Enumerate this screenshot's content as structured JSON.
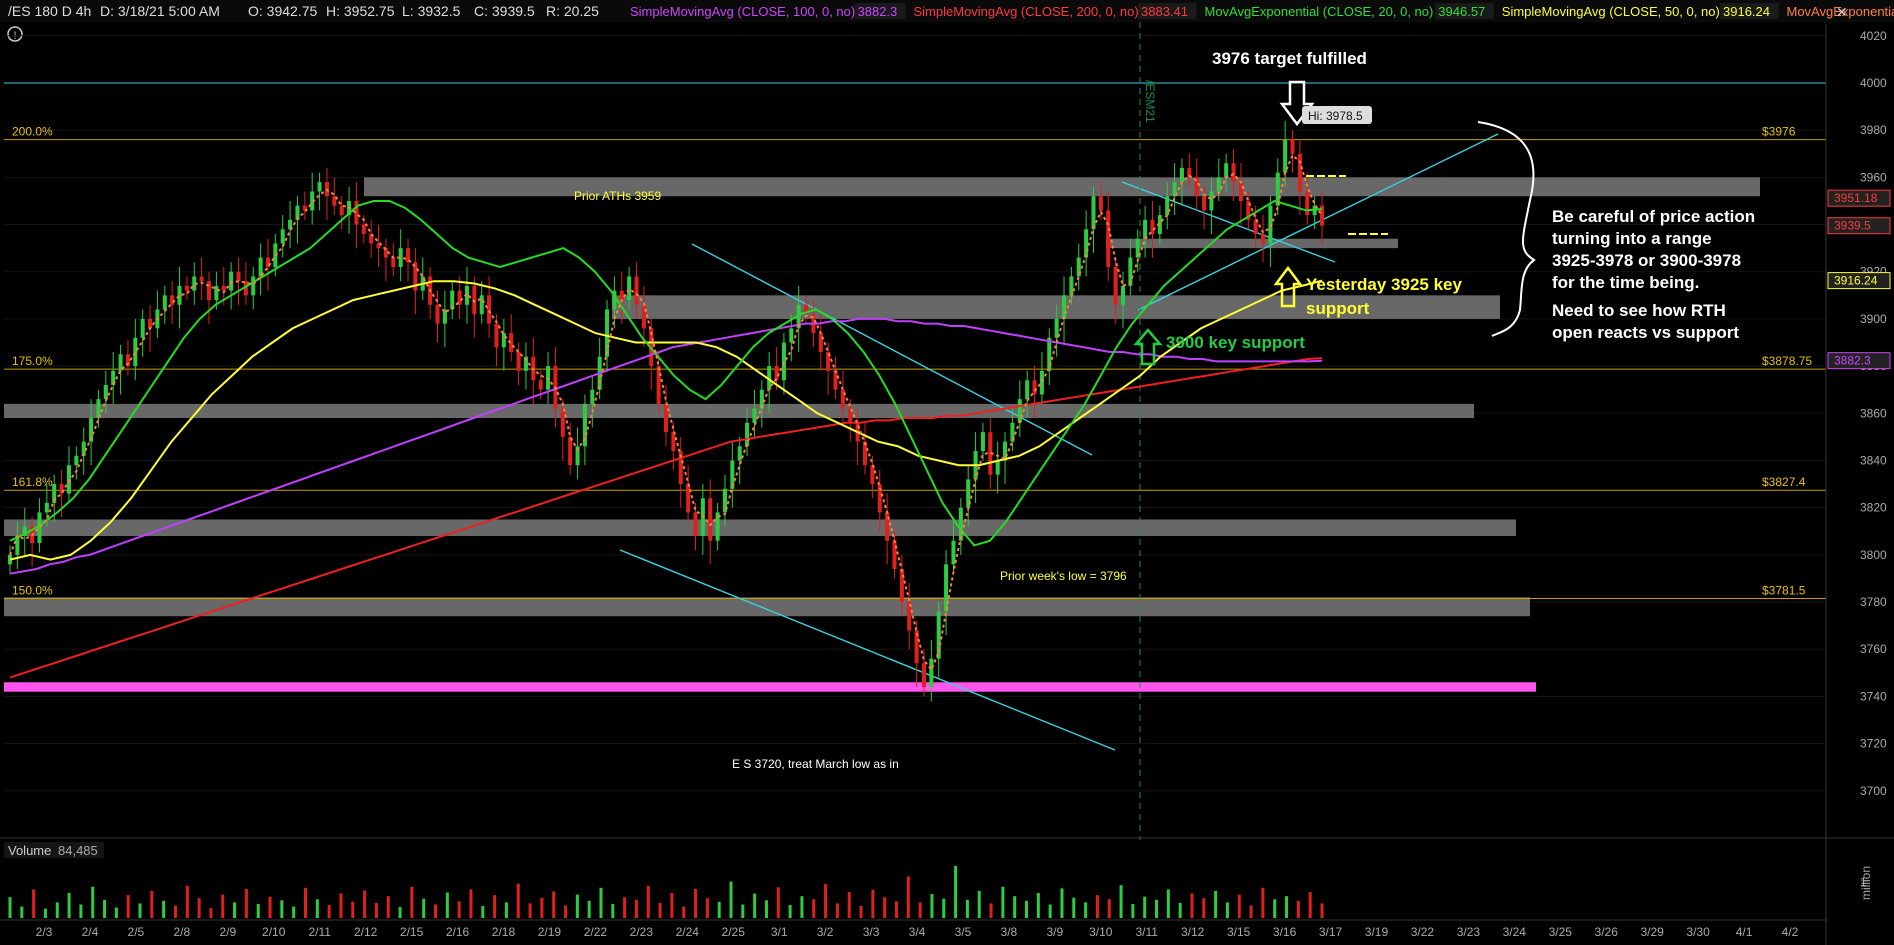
{
  "header": {
    "symbol": "/ES 180 D 4h",
    "date": "D: 3/18/21 5:00 AM",
    "open": "O: 3942.75",
    "high": "H: 3952.75",
    "low": "L: 3932.5",
    "close": "C: 3939.5",
    "range": "R: 20.25",
    "studies": [
      {
        "label": "SimpleMovingAvg (CLOSE, 100, 0, no)",
        "value": "3882.3",
        "color": "#cc44ff"
      },
      {
        "label": "SimpleMovingAvg (CLOSE, 200, 0, no)",
        "value": "3883.41",
        "color": "#ff3a3a"
      },
      {
        "label": "MovAvgExponential (CLOSE, 20, 0, no)",
        "value": "3946.57",
        "color": "#33dd33"
      },
      {
        "label": "SimpleMovingAvg (CLOSE, 50, 0, no)",
        "value": "3916.24",
        "color": "#ffff33"
      },
      {
        "label": "MovAvgExponential ...",
        "value": "",
        "color": "#ff8040"
      }
    ]
  },
  "volume_panel": {
    "label": "Volume",
    "value": "84,485",
    "unit": "million"
  },
  "chart_data": {
    "type": "candlestick",
    "ylim": [
      3680,
      4025
    ],
    "y_ticks": [
      3700,
      3720,
      3740,
      3760,
      3780,
      3800,
      3820,
      3840,
      3860,
      3880,
      3900,
      3920,
      3940,
      3960,
      3980,
      4000,
      4020
    ],
    "x_ticks": [
      "2/3",
      "2/4",
      "2/5",
      "2/8",
      "2/9",
      "2/10",
      "2/11",
      "2/12",
      "2/15",
      "2/16",
      "2/18",
      "2/19",
      "2/22",
      "2/23",
      "2/24",
      "2/25",
      "3/1",
      "3/2",
      "3/3",
      "3/4",
      "3/5",
      "3/8",
      "3/9",
      "3/10",
      "3/11",
      "3/12",
      "3/15",
      "3/16",
      "3/17",
      "3/19",
      "3/22",
      "3/23",
      "3/24",
      "3/25",
      "3/26",
      "3/29",
      "3/30",
      "4/1",
      "4/2"
    ],
    "series_close": [
      3800,
      3808,
      3812,
      3805,
      3818,
      3822,
      3830,
      3826,
      3838,
      3842,
      3848,
      3858,
      3866,
      3872,
      3878,
      3885,
      3880,
      3892,
      3900,
      3896,
      3904,
      3910,
      3906,
      3914,
      3912,
      3918,
      3916,
      3908,
      3914,
      3912,
      3920,
      3916,
      3910,
      3918,
      3926,
      3922,
      3932,
      3938,
      3942,
      3948,
      3946,
      3954,
      3958,
      3952,
      3948,
      3944,
      3950,
      3940,
      3936,
      3932,
      3930,
      3926,
      3922,
      3930,
      3924,
      3912,
      3918,
      3906,
      3898,
      3904,
      3912,
      3906,
      3914,
      3902,
      3910,
      3898,
      3888,
      3894,
      3886,
      3878,
      3884,
      3874,
      3870,
      3880,
      3862,
      3850,
      3838,
      3846,
      3864,
      3870,
      3884,
      3904,
      3912,
      3908,
      3918,
      3906,
      3896,
      3880,
      3864,
      3852,
      3844,
      3830,
      3818,
      3808,
      3824,
      3806,
      3818,
      3828,
      3840,
      3846,
      3856,
      3862,
      3870,
      3880,
      3874,
      3890,
      3896,
      3906,
      3902,
      3894,
      3886,
      3878,
      3870,
      3862,
      3856,
      3848,
      3838,
      3830,
      3818,
      3806,
      3794,
      3780,
      3768,
      3754,
      3744,
      3756,
      3776,
      3796,
      3806,
      3820,
      3832,
      3844,
      3852,
      3834,
      3840,
      3848,
      3856,
      3866,
      3874,
      3868,
      3878,
      3892,
      3900,
      3910,
      3918,
      3926,
      3938,
      3952,
      3946,
      3922,
      3906,
      3914,
      3926,
      3934,
      3942,
      3936,
      3944,
      3952,
      3958,
      3964,
      3960,
      3952,
      3946,
      3954,
      3960,
      3966,
      3958,
      3950,
      3942,
      3936,
      3932,
      3948,
      3962,
      3976,
      3970,
      3954,
      3944,
      3948,
      3939.5
    ],
    "sma100": [
      3792,
      3793,
      3794,
      3796,
      3797,
      3799,
      3800,
      3802,
      3804,
      3806,
      3808,
      3810,
      3812,
      3814,
      3816,
      3818,
      3820,
      3822,
      3824,
      3826,
      3828,
      3830,
      3832,
      3834,
      3836,
      3838,
      3840,
      3842,
      3844,
      3846,
      3848,
      3850,
      3852,
      3854,
      3856,
      3858,
      3860,
      3862,
      3864,
      3866,
      3868,
      3870,
      3872,
      3874,
      3876,
      3878,
      3880,
      3882,
      3884,
      3886,
      3888,
      3889,
      3890,
      3891,
      3892,
      3893,
      3894,
      3895,
      3896,
      3897,
      3898,
      3898,
      3899,
      3899,
      3900,
      3900,
      3900,
      3899,
      3899,
      3898,
      3898,
      3897,
      3897,
      3896,
      3895,
      3894,
      3893,
      3892,
      3891,
      3890,
      3889,
      3888,
      3887,
      3886,
      3886,
      3885,
      3885,
      3884,
      3884,
      3883,
      3883,
      3882,
      3882,
      3882,
      3882,
      3882,
      3882,
      3882,
      3882,
      3882.3
    ],
    "sma200": [
      3748,
      3750,
      3752,
      3754,
      3756,
      3758,
      3760,
      3762,
      3764,
      3766,
      3768,
      3770,
      3772,
      3774,
      3776,
      3778,
      3780,
      3782,
      3784,
      3786,
      3788,
      3790,
      3792,
      3794,
      3796,
      3798,
      3800,
      3802,
      3804,
      3806,
      3808,
      3810,
      3812,
      3814,
      3816,
      3818,
      3820,
      3822,
      3824,
      3826,
      3828,
      3830,
      3832,
      3834,
      3836,
      3838,
      3840,
      3842,
      3844,
      3846,
      3848,
      3849,
      3850,
      3851,
      3852,
      3853,
      3854,
      3855,
      3856,
      3856,
      3857,
      3857,
      3858,
      3858,
      3858,
      3859,
      3859,
      3860,
      3861,
      3862,
      3863,
      3864,
      3865,
      3866,
      3867,
      3868,
      3869,
      3870,
      3871,
      3872,
      3873,
      3874,
      3875,
      3876,
      3877,
      3878,
      3879,
      3880,
      3881,
      3882,
      3883,
      3883.41
    ],
    "ema20": [
      3806,
      3809,
      3813,
      3818,
      3824,
      3832,
      3842,
      3852,
      3862,
      3872,
      3882,
      3892,
      3900,
      3906,
      3910,
      3914,
      3918,
      3922,
      3926,
      3930,
      3936,
      3942,
      3948,
      3950,
      3950,
      3947,
      3942,
      3936,
      3930,
      3926,
      3924,
      3922,
      3924,
      3926,
      3928,
      3930,
      3926,
      3920,
      3912,
      3902,
      3892,
      3884,
      3876,
      3870,
      3866,
      3872,
      3880,
      3888,
      3894,
      3898,
      3902,
      3904,
      3900,
      3894,
      3886,
      3876,
      3864,
      3850,
      3836,
      3822,
      3812,
      3804,
      3806,
      3814,
      3824,
      3834,
      3844,
      3854,
      3864,
      3876,
      3888,
      3898,
      3906,
      3914,
      3920,
      3926,
      3932,
      3938,
      3942,
      3946,
      3950,
      3948,
      3946,
      3946.57
    ],
    "sma50": [
      3798,
      3800,
      3798,
      3800,
      3806,
      3814,
      3824,
      3836,
      3848,
      3858,
      3868,
      3876,
      3884,
      3890,
      3896,
      3900,
      3904,
      3908,
      3910,
      3912,
      3914,
      3916,
      3916,
      3915,
      3913,
      3910,
      3906,
      3902,
      3898,
      3894,
      3892,
      3890,
      3890,
      3890,
      3890,
      3888,
      3884,
      3878,
      3872,
      3866,
      3860,
      3856,
      3852,
      3848,
      3846,
      3842,
      3840,
      3838,
      3838,
      3840,
      3842,
      3846,
      3852,
      3858,
      3864,
      3870,
      3876,
      3884,
      3890,
      3896,
      3900,
      3904,
      3908,
      3912,
      3914,
      3916.24
    ],
    "horizontal_levels": [
      {
        "label": "200.0%",
        "value": "$3976",
        "price": 3976
      },
      {
        "label": "175.0%",
        "value": "$3878.75",
        "price": 3878.75
      },
      {
        "label": "161.8%",
        "value": "$3827.4",
        "price": 3827.4
      },
      {
        "label": "150.0%",
        "value": "$3781.5",
        "price": 3781.5
      }
    ],
    "right_labels": [
      {
        "text": "3951.18",
        "price": 3951.18,
        "color": "#ff3a3a"
      },
      {
        "text": "3939.5",
        "price": 3939.5,
        "color": "#ff3a3a"
      },
      {
        "text": "3916.24",
        "price": 3916.24,
        "color": "#ffff33"
      },
      {
        "text": "3882.3",
        "price": 3882.3,
        "color": "#cc44ff"
      }
    ],
    "zones": [
      {
        "low": 3952,
        "high": 3960
      },
      {
        "low": 3930,
        "high": 3934
      },
      {
        "low": 3900,
        "high": 3910
      },
      {
        "low": 3858,
        "high": 3864
      },
      {
        "low": 3808,
        "high": 3815
      },
      {
        "low": 3774,
        "high": 3782
      },
      {
        "low": 3742,
        "high": 3746,
        "color": "#ff55ee"
      }
    ],
    "hi_marker": "Hi: 3978.5",
    "contract_label": "/ESM21",
    "annotations": {
      "target": "3976 target fulfilled",
      "prior_aths": "Prior ATHs 3959",
      "yesterday_support_1": "Yesterday 3925 key",
      "yesterday_support_2": "support",
      "key_support_3900": "3900 key support",
      "prior_week_low": "Prior week's low = 3796",
      "march_low": "E S 3720, treat March low as in",
      "careful": [
        "Be careful of price action",
        "turning into a range",
        "3925-3978 or 3900-3978",
        "for the time being.",
        "Need to see how RTH",
        "open reacts vs support"
      ]
    },
    "volume": [
      40,
      22,
      55,
      18,
      30,
      48,
      26,
      60,
      35,
      20,
      44,
      28,
      52,
      33,
      24,
      62,
      38,
      19,
      45,
      30,
      56,
      27,
      41,
      34,
      22,
      58,
      36,
      25,
      47,
      31,
      53,
      29,
      42,
      21,
      60,
      37,
      26,
      49,
      32,
      55,
      23,
      44,
      30,
      66,
      28,
      39,
      51,
      24,
      45,
      33,
      58,
      27,
      40,
      35,
      62,
      29,
      48,
      22,
      56,
      38,
      31,
      70,
      26,
      47,
      34,
      59,
      25,
      42,
      36,
      65,
      28,
      50,
      23,
      54,
      40,
      32,
      80,
      30,
      46,
      37,
      100,
      35,
      52,
      28,
      60,
      42,
      33,
      48,
      26,
      57,
      39,
      30,
      44,
      36,
      63,
      27,
      41,
      35,
      55,
      29,
      47,
      38,
      52,
      30,
      45,
      24,
      58,
      36,
      42,
      33,
      50,
      28
    ]
  }
}
